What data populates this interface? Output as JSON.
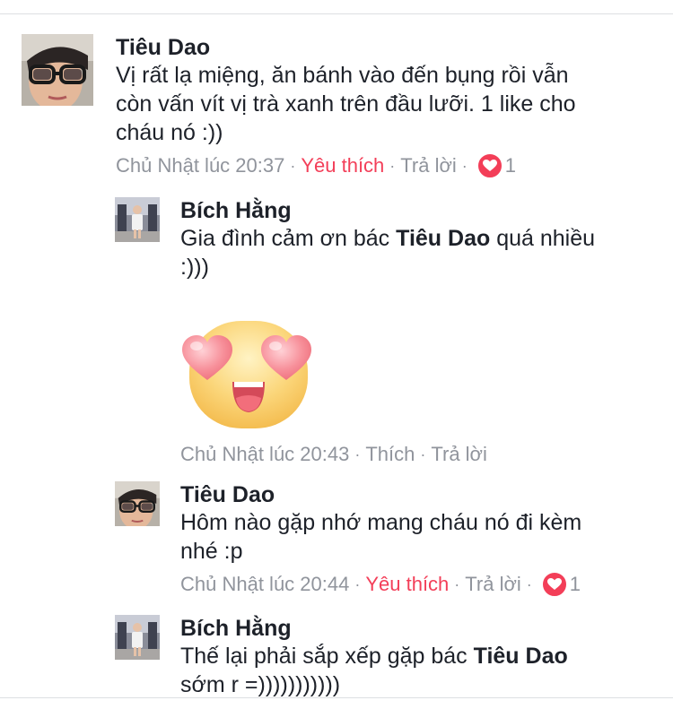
{
  "comments": [
    {
      "author": "Tiêu Dao",
      "text_lines": [
        "Vị rất lạ miệng, ăn bánh vào đến bụng rồi vẫn",
        "còn vấn vít vị trà xanh trên đầu lưỡi. 1 like cho",
        "cháu nó :))"
      ],
      "time": "Chủ Nhật lúc 20:37",
      "like_label": "Yêu thích",
      "reply_label": "Trả lời",
      "reaction_count": "1"
    },
    {
      "author": "Bích Hằng",
      "text_part1": "Gia đình cảm ơn bác ",
      "mention": "Tiêu Dao",
      "text_part2": " quá nhiều",
      "text_line2": ":)))",
      "sticker": "heart-eyes-emoji",
      "time": "Chủ Nhật lúc 20:43",
      "like_label": "Thích",
      "reply_label": "Trả lời"
    },
    {
      "author": "Tiêu Dao",
      "text_lines": [
        "Hôm nào gặp nhớ mang cháu nó đi kèm",
        "nhé :p"
      ],
      "time": "Chủ Nhật lúc 20:44",
      "like_label": "Yêu thích",
      "reply_label": "Trả lời",
      "reaction_count": "1"
    },
    {
      "author": "Bích Hằng",
      "text_part1": "Thế lại phải sắp xếp gặp bác ",
      "mention": "Tiêu Dao",
      "text_line2": "sớm r =)))))))))))"
    }
  ],
  "separator": "·",
  "colors": {
    "liked": "#f33e58",
    "meta": "#90949c",
    "text": "#1d2129",
    "divider": "#dddfe2"
  }
}
